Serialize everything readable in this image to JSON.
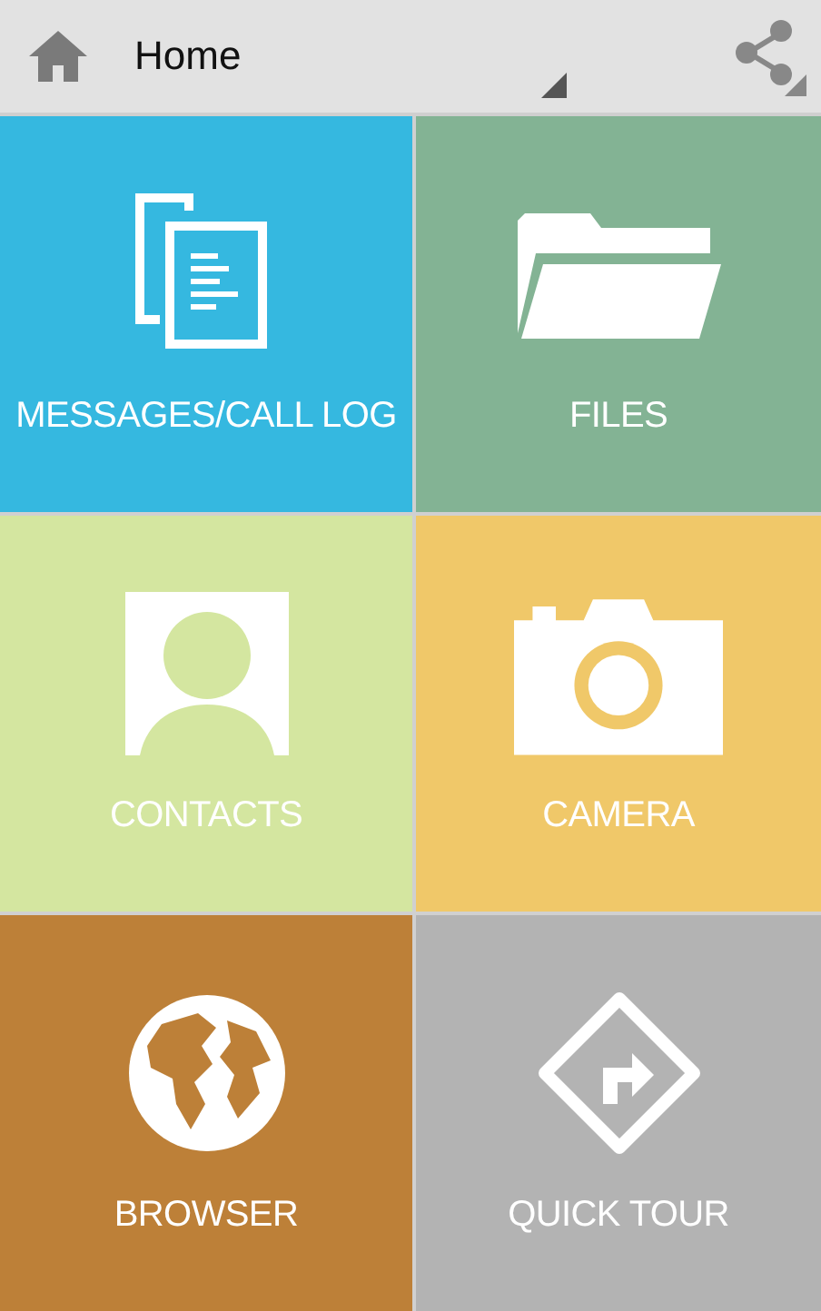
{
  "action_bar": {
    "title": "Home"
  },
  "tiles": [
    {
      "kind": "messages",
      "label": "MESSAGES/CALL LOG",
      "color": "#35b8e0"
    },
    {
      "kind": "files",
      "label": "FILES",
      "color": "#83b394"
    },
    {
      "kind": "contacts",
      "label": "CONTACTS",
      "color": "#d4e6a0"
    },
    {
      "kind": "camera",
      "label": "CAMERA",
      "color": "#f0c869"
    },
    {
      "kind": "browser",
      "label": "BROWSER",
      "color": "#bd8038"
    },
    {
      "kind": "tour",
      "label": "QUICK TOUR",
      "color": "#b3b3b3"
    }
  ]
}
